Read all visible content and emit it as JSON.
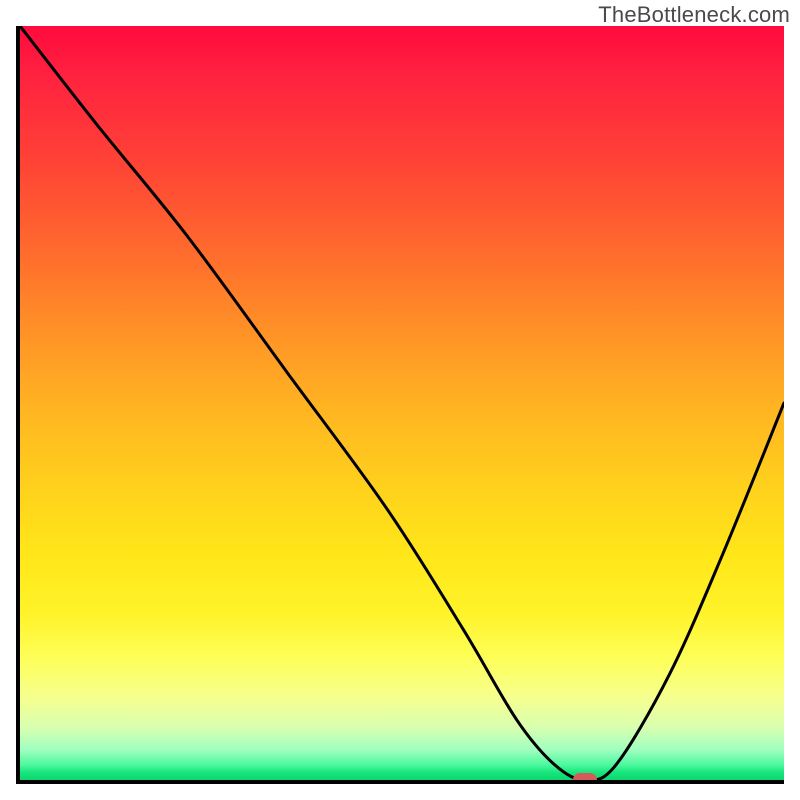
{
  "watermark": "TheBottleneck.com",
  "chart_data": {
    "type": "line",
    "title": "",
    "xlabel": "",
    "ylabel": "",
    "xlim": [
      0,
      100
    ],
    "ylim": [
      0,
      100
    ],
    "background_gradient": {
      "top_color": "#ff0a3c",
      "bottom_color": "#0dd66f",
      "description": "vertical red-to-green heat gradient (high=bad, low=good)"
    },
    "series": [
      {
        "name": "bottleneck-curve",
        "x": [
          0,
          10,
          22,
          35,
          48,
          58,
          65,
          70,
          74,
          78,
          85,
          92,
          100
        ],
        "y": [
          100,
          87,
          72,
          54,
          36,
          20,
          8,
          2,
          0,
          2,
          14,
          30,
          50
        ]
      }
    ],
    "marker": {
      "x": 74,
      "y": 0,
      "label": "optimal-point"
    },
    "grid": false,
    "legend": false
  },
  "colors": {
    "curve": "#000000",
    "marker": "#d65a5a",
    "axis": "#000000"
  }
}
